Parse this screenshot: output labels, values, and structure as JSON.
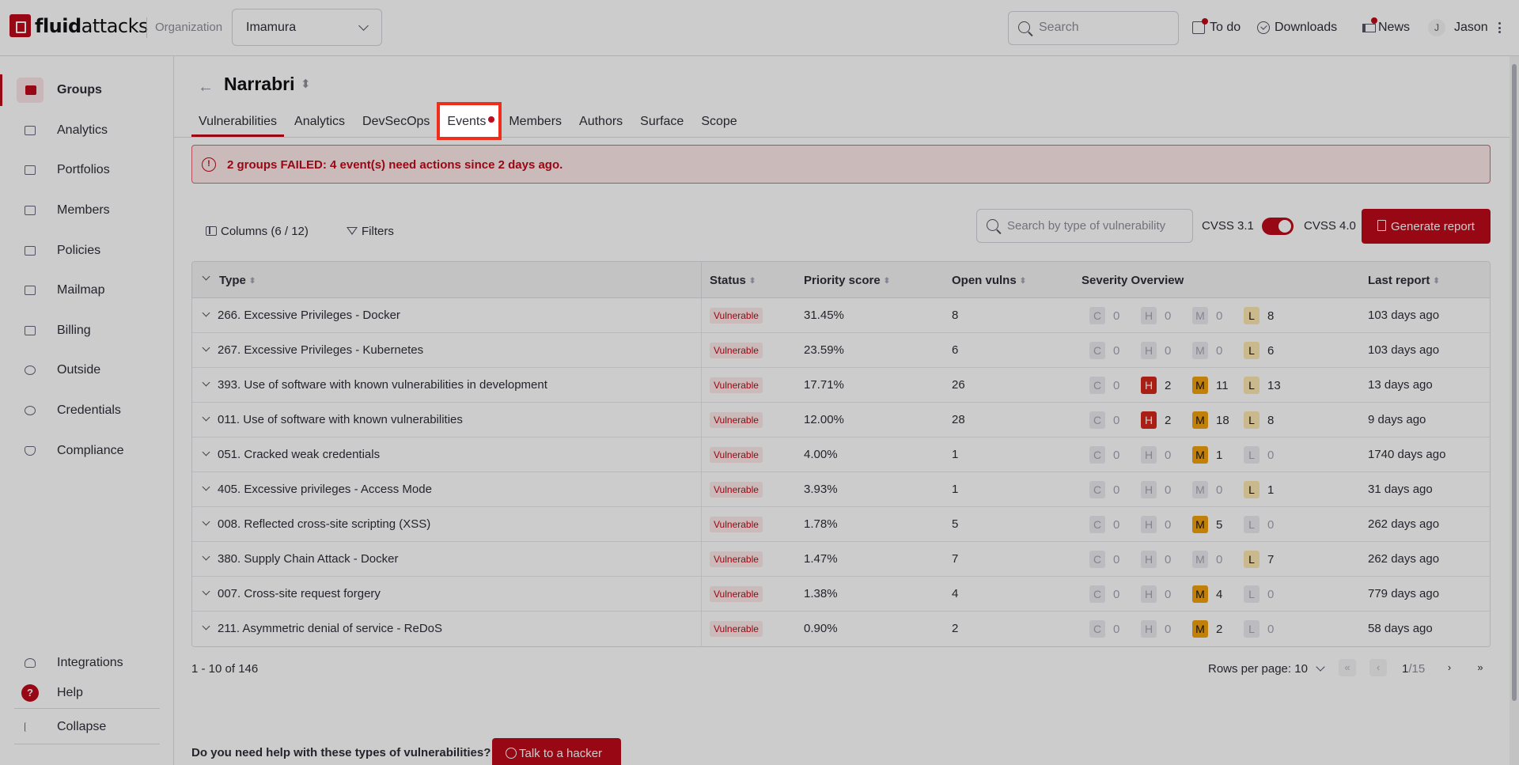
{
  "header": {
    "logo_bold": "fluid",
    "logo_light": "attacks",
    "org_label": "Organization",
    "org_value": "Imamura",
    "search_placeholder": "Search",
    "todo": "To do",
    "downloads": "Downloads",
    "news": "News",
    "avatar_initial": "J",
    "user_name": "Jason"
  },
  "sidebar": {
    "items": [
      {
        "label": "Groups",
        "icon": "folder-icon"
      },
      {
        "label": "Analytics",
        "icon": "bar-chart-icon"
      },
      {
        "label": "Portfolios",
        "icon": "briefcase-icon"
      },
      {
        "label": "Members",
        "icon": "user-plus-icon"
      },
      {
        "label": "Policies",
        "icon": "policy-icon"
      },
      {
        "label": "Mailmap",
        "icon": "mail-icon"
      },
      {
        "label": "Billing",
        "icon": "billing-icon"
      },
      {
        "label": "Outside",
        "icon": "info-circle-icon"
      },
      {
        "label": "Credentials",
        "icon": "key-icon"
      },
      {
        "label": "Compliance",
        "icon": "shield-icon"
      }
    ],
    "integrations": "Integrations",
    "help": "Help",
    "help_icon_glyph": "?",
    "collapse": "Collapse"
  },
  "group": {
    "back_glyph": "←",
    "name": "Narrabri",
    "sort_glyph": "⬍"
  },
  "tabs": [
    "Vulnerabilities",
    "Analytics",
    "DevSecOps",
    "Events",
    "Members",
    "Authors",
    "Surface",
    "Scope"
  ],
  "alert": {
    "icon_glyph": "!",
    "text": "2 groups FAILED: 4 event(s) need actions since 2 days ago."
  },
  "toolbar": {
    "columns": "Columns (6 / 12)",
    "filters": "Filters",
    "search_placeholder": "Search by type of vulnerability",
    "cvss_left": "CVSS 3.1",
    "cvss_right": "CVSS 4.0",
    "cvss_toggle_on": true,
    "generate_report": "Generate report"
  },
  "table": {
    "headers": {
      "type": "Type",
      "status": "Status",
      "priority": "Priority score",
      "open": "Open vulns",
      "severity": "Severity Overview",
      "last": "Last report",
      "sort_glyph": "⬍"
    },
    "severity_letters": [
      "C",
      "H",
      "M",
      "L"
    ],
    "rows": [
      {
        "type": "266. Excessive Privileges - Docker",
        "status": "Vulnerable",
        "priority": "31.45%",
        "open": "8",
        "sev": [
          0,
          0,
          0,
          8
        ],
        "last": "103 days ago"
      },
      {
        "type": "267. Excessive Privileges - Kubernetes",
        "status": "Vulnerable",
        "priority": "23.59%",
        "open": "6",
        "sev": [
          0,
          0,
          0,
          6
        ],
        "last": "103 days ago"
      },
      {
        "type": "393. Use of software with known vulnerabilities in development",
        "status": "Vulnerable",
        "priority": "17.71%",
        "open": "26",
        "sev": [
          0,
          2,
          11,
          13
        ],
        "last": "13 days ago"
      },
      {
        "type": "011. Use of software with known vulnerabilities",
        "status": "Vulnerable",
        "priority": "12.00%",
        "open": "28",
        "sev": [
          0,
          2,
          18,
          8
        ],
        "last": "9 days ago"
      },
      {
        "type": "051. Cracked weak credentials",
        "status": "Vulnerable",
        "priority": "4.00%",
        "open": "1",
        "sev": [
          0,
          0,
          1,
          0
        ],
        "last": "1740 days ago"
      },
      {
        "type": "405. Excessive privileges - Access Mode",
        "status": "Vulnerable",
        "priority": "3.93%",
        "open": "1",
        "sev": [
          0,
          0,
          0,
          1
        ],
        "last": "31 days ago"
      },
      {
        "type": "008. Reflected cross-site scripting (XSS)",
        "status": "Vulnerable",
        "priority": "1.78%",
        "open": "5",
        "sev": [
          0,
          0,
          5,
          0
        ],
        "last": "262 days ago"
      },
      {
        "type": "380. Supply Chain Attack - Docker",
        "status": "Vulnerable",
        "priority": "1.47%",
        "open": "7",
        "sev": [
          0,
          0,
          0,
          7
        ],
        "last": "262 days ago"
      },
      {
        "type": "007. Cross-site request forgery",
        "status": "Vulnerable",
        "priority": "1.38%",
        "open": "4",
        "sev": [
          0,
          0,
          4,
          0
        ],
        "last": "779 days ago"
      },
      {
        "type": "211. Asymmetric denial of service - ReDoS",
        "status": "Vulnerable",
        "priority": "0.90%",
        "open": "2",
        "sev": [
          0,
          0,
          2,
          0
        ],
        "last": "58 days ago"
      }
    ]
  },
  "pager": {
    "range": "1 - 10 of 146",
    "rows_per_page": "Rows per page: 10",
    "page": "1",
    "total": "/15",
    "first_glyph": "«",
    "prev_glyph": "‹",
    "next_glyph": "›",
    "last_glyph": "»"
  },
  "footer": {
    "question": "Do you need help with these types of vulnerabilities?",
    "button": "Talk to a hacker"
  },
  "colors": {
    "brand": "#bf0b1a",
    "critical": "#9a0914",
    "high": "#d5271b",
    "medium": "#f2a10c",
    "low": "#fde8b0",
    "highlight_box": "#ef2d1a"
  }
}
